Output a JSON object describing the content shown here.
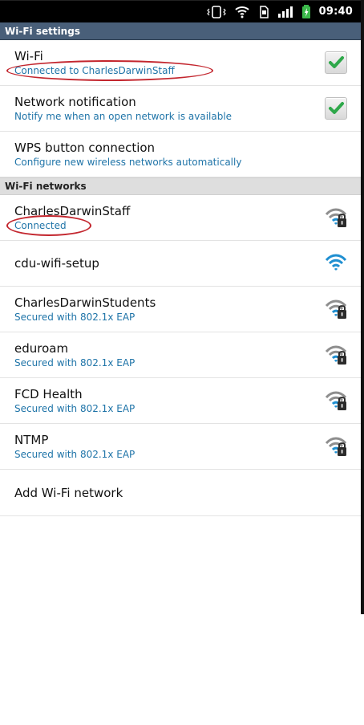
{
  "status_bar": {
    "time": "09:40",
    "icons": [
      "vibrate-icon",
      "wifi-icon",
      "sim-icon",
      "signal-icon",
      "battery-icon"
    ],
    "colors": {
      "background": "#000000",
      "battery": "#3bb84a"
    }
  },
  "wifi_settings": {
    "header": "Wi-Fi settings",
    "items": [
      {
        "title": "Wi-Fi",
        "subtitle": "Connected to CharlesDarwinStaff",
        "checked": true
      },
      {
        "title": "Network notification",
        "subtitle": "Notify me when an open network is available",
        "checked": true
      },
      {
        "title": "WPS button connection",
        "subtitle": "Configure new wireless networks automatically"
      }
    ]
  },
  "wifi_networks": {
    "header": "Wi-Fi networks",
    "networks": [
      {
        "name": "CharlesDarwinStaff",
        "status": "Connected",
        "icon": "wifi-locked-icon"
      },
      {
        "name": "cdu-wifi-setup",
        "status": "",
        "icon": "wifi-open-icon"
      },
      {
        "name": "CharlesDarwinStudents",
        "status": "Secured with 802.1x EAP",
        "icon": "wifi-locked-icon"
      },
      {
        "name": "eduroam",
        "status": "Secured with 802.1x EAP",
        "icon": "wifi-locked-icon"
      },
      {
        "name": "FCD Health",
        "status": "Secured with 802.1x EAP",
        "icon": "wifi-locked-icon"
      },
      {
        "name": "NTMP",
        "status": "Secured with 802.1x EAP",
        "icon": "wifi-locked-icon"
      }
    ],
    "add_network": "Add Wi-Fi network"
  },
  "colors": {
    "settings_header_bg": "#495f79",
    "networks_header_bg": "#dedede",
    "subtitle_blue": "#1f74a8",
    "check_green": "#2ea84a",
    "callout_red": "#c3262e",
    "wifi_blue": "#1f8fd1",
    "wifi_gray": "#8e8e8e"
  }
}
